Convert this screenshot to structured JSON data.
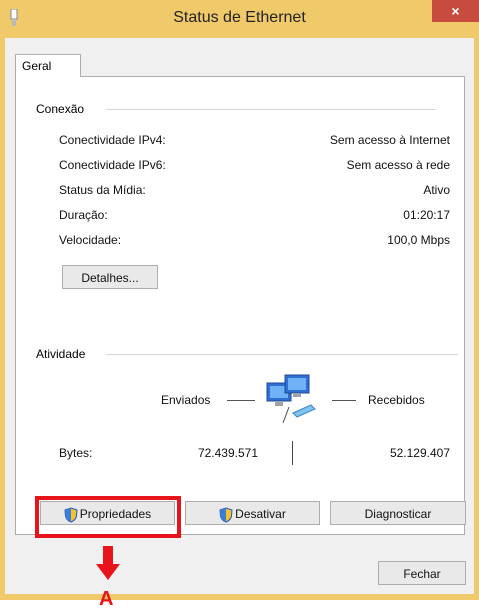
{
  "window": {
    "title": "Status de Ethernet",
    "close_glyph": "×"
  },
  "tabs": [
    {
      "label": "Geral",
      "active": true
    }
  ],
  "connection": {
    "group_label": "Conexão",
    "rows": [
      {
        "label": "Conectividade IPv4:",
        "value": "Sem acesso à Internet"
      },
      {
        "label": "Conectividade IPv6:",
        "value": "Sem acesso à rede"
      },
      {
        "label": "Status da Mídia:",
        "value": "Ativo"
      },
      {
        "label": "Duração:",
        "value": "01:20:17"
      },
      {
        "label": "Velocidade:",
        "value": "100,0 Mbps"
      }
    ],
    "details_button": "Detalhes..."
  },
  "activity": {
    "group_label": "Atividade",
    "sent_label": "Enviados",
    "received_label": "Recebidos",
    "bytes_label": "Bytes:",
    "bytes_sent": "72.439.571",
    "bytes_received": "52.129.407",
    "icon": "network-computers-icon"
  },
  "buttons": {
    "properties": "Propriedades",
    "disable": "Desativar",
    "diagnose": "Diagnosticar",
    "close": "Fechar"
  },
  "annotation": {
    "label": "A",
    "color": "#e8141b"
  },
  "colors": {
    "title_bar": "#f0c96b",
    "close_button": "#c74b3f"
  }
}
